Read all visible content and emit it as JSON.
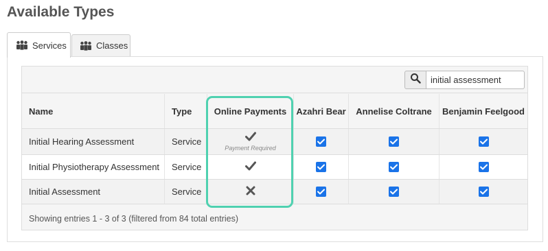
{
  "page": {
    "title": "Available Types"
  },
  "tabs": [
    {
      "label": "Services",
      "icon": "people-icon",
      "active": true
    },
    {
      "label": "Classes",
      "icon": "people-icon",
      "active": false
    }
  ],
  "search": {
    "value": "initial assessment",
    "icon": "search-icon"
  },
  "table": {
    "headers": [
      "Name",
      "Type",
      "Online Payments",
      "Azahri Bear",
      "Annelise Coltrane",
      "Benjamin Feelgood"
    ],
    "rows": [
      {
        "name": "Initial Hearing Assessment",
        "type": "Service",
        "payment": "check",
        "payment_note": "Payment Required",
        "azahri": true,
        "annelise": true,
        "benjamin": true
      },
      {
        "name": "Initial Physiotherapy Assessment",
        "type": "Service",
        "payment": "check",
        "payment_note": "",
        "azahri": true,
        "annelise": true,
        "benjamin": true
      },
      {
        "name": "Initial Assessment",
        "type": "Service",
        "payment": "cross",
        "payment_note": "",
        "azahri": true,
        "annelise": true,
        "benjamin": true
      }
    ],
    "footer": "Showing entries 1 - 3 of 3 (filtered from 84 total entries)"
  },
  "colors": {
    "highlight": "#4fd1b0",
    "checkbox": "#1a73e8",
    "title": "#555555"
  }
}
